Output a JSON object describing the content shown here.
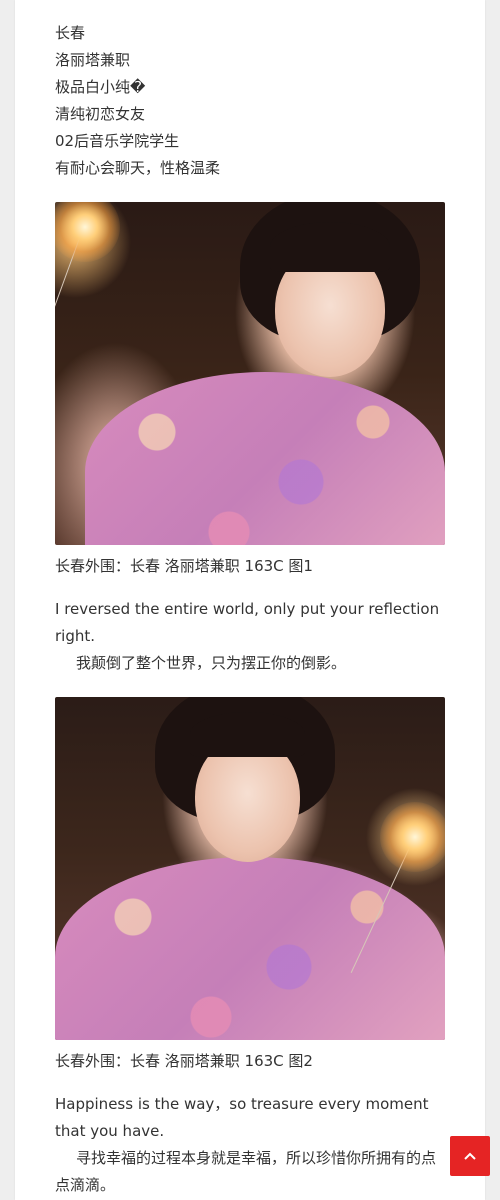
{
  "profile_lines": [
    "长春",
    "洛丽塔兼职",
    "极品白小纯�",
    "清纯初恋女友",
    "02后音乐学院学生",
    "有耐心会聊天，性格温柔"
  ],
  "photo1": {
    "caption": "长春外围：长春 洛丽塔兼职 163C 图1"
  },
  "quote1": {
    "en": "I reversed the entire world, only put your reflection right.",
    "zh": "我颠倒了整个世界，只为摆正你的倒影。"
  },
  "photo2": {
    "caption": "长春外围：长春 洛丽塔兼职 163C 图2"
  },
  "quote2": {
    "en": "Happiness is the way，so treasure every moment that you have.",
    "zh": "寻找幸福的过程本身就是幸福，所以珍惜你所拥有的点点滴滴。"
  },
  "scroll_top_button": {
    "icon": "chevron-up-icon",
    "color": "#e52424"
  }
}
